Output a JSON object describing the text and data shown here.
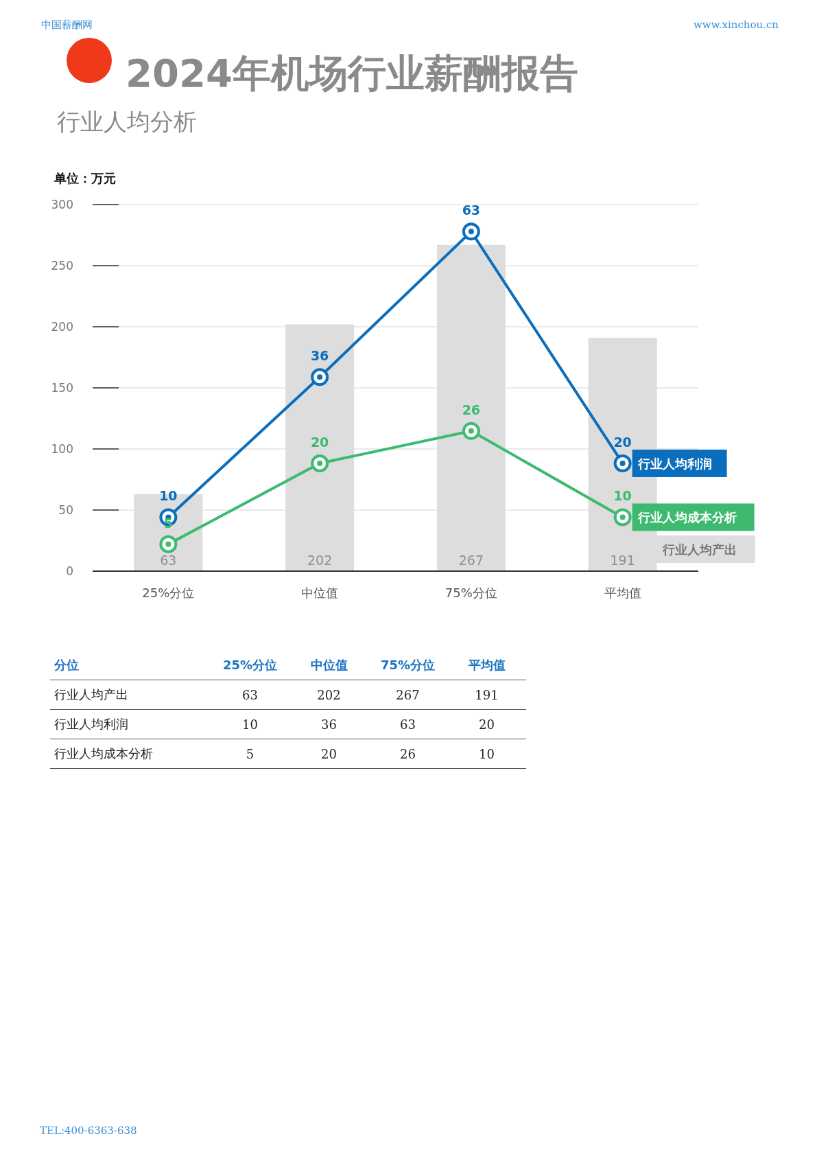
{
  "header": {
    "site_name": "中国薪酬网",
    "url": "www.xinchou.cn"
  },
  "title": "2024年机场行业薪酬报告",
  "subtitle": "行业人均分析",
  "unit": "单位：万元",
  "chart": {
    "chart_data": {
      "type": "bar",
      "categories": [
        "25%分位",
        "中位值",
        "75%分位",
        "平均值"
      ],
      "ylim": [
        0,
        300
      ],
      "yticks": [
        0,
        50,
        100,
        150,
        200,
        250,
        300
      ],
      "grid": true,
      "data_labels": true,
      "series": [
        {
          "name": "行业人均产出",
          "color": "#dddddd",
          "values": [
            63,
            202,
            267,
            191
          ]
        }
      ]
    },
    "overlay_lines": [
      {
        "name": "行业人均利润",
        "color": "#0a6ebd",
        "labels": [
          "10",
          "36",
          "63",
          "20"
        ]
      },
      {
        "name": "行业人均成本分析",
        "color": "#3dba6f",
        "labels": [
          "5",
          "20",
          "26",
          "10"
        ]
      }
    ]
  },
  "table": {
    "columns": [
      "分位",
      "25%分位",
      "中位值",
      "75%分位",
      "平均值"
    ],
    "rows": [
      {
        "cells": [
          "行业人均产出",
          "63",
          "202",
          "267",
          "191"
        ]
      },
      {
        "cells": [
          "行业人均利润",
          "10",
          "36",
          "63",
          "20"
        ]
      },
      {
        "cells": [
          "行业人均成本分析",
          "5",
          "20",
          "26",
          "10"
        ]
      }
    ]
  },
  "footer": "TEL:400-6363-638"
}
